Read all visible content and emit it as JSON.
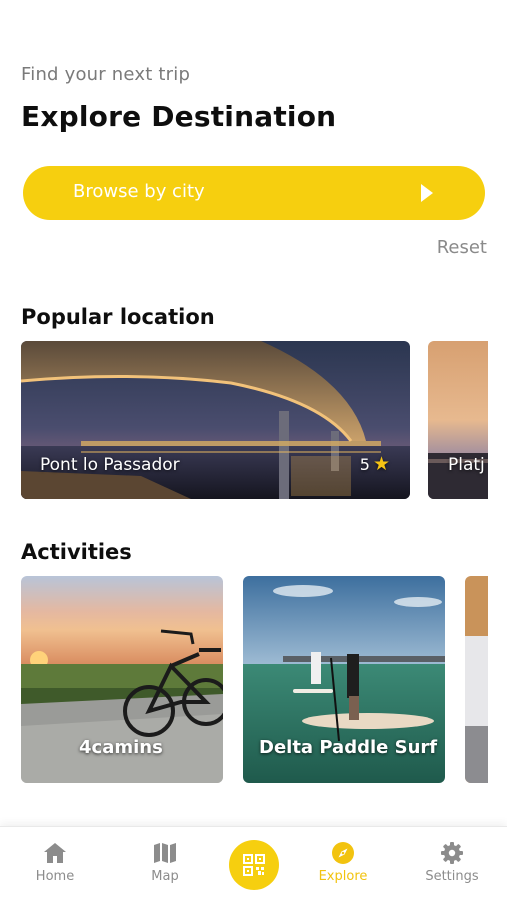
{
  "header": {
    "subtitle": "Find your next trip",
    "title": "Explore Destination"
  },
  "browse": {
    "label": "Browse by city",
    "icon": "play-arrow-icon"
  },
  "reset_label": "Reset",
  "popular": {
    "title": "Popular location",
    "items": [
      {
        "name": "Pont lo Passador",
        "rating": "5"
      },
      {
        "name": "Platj"
      }
    ]
  },
  "activities": {
    "title": "Activities",
    "items": [
      {
        "name": "4camins"
      },
      {
        "name": "Delta Paddle Surf"
      }
    ]
  },
  "nav": {
    "items": [
      {
        "label": "Home",
        "icon": "home-icon"
      },
      {
        "label": "Map",
        "icon": "map-icon"
      },
      {
        "label": "",
        "icon": "qr-code-icon"
      },
      {
        "label": "Explore",
        "icon": "compass-icon",
        "active": true
      },
      {
        "label": "Settings",
        "icon": "gear-icon"
      }
    ]
  },
  "colors": {
    "accent": "#f6cf0f",
    "active_nav": "#f2c30f",
    "muted_text": "#8c8c8c"
  }
}
